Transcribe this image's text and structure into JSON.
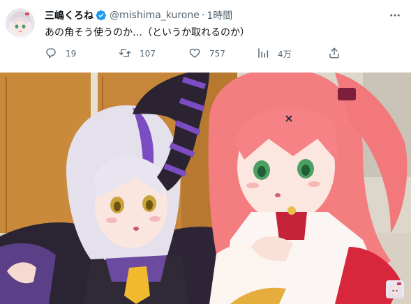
{
  "user": {
    "display_name": "三嶋くろね",
    "handle": "@mishima_kurone",
    "separator": "·",
    "time": "1時間"
  },
  "tweet": {
    "text": "あの角そう使うのか…（というか取れるのか）"
  },
  "actions": {
    "replies": "19",
    "retweets": "107",
    "likes": "757",
    "views": "4万"
  },
  "icons": {
    "verified": "verified-badge-icon",
    "more": "more-dots-icon",
    "reply": "reply-icon",
    "retweet": "retweet-icon",
    "like": "heart-icon",
    "views": "analytics-icon",
    "share": "share-icon"
  },
  "colors": {
    "verified_blue": "#1d9bf0",
    "text_secondary": "#536471",
    "text_primary": "#0f1419"
  }
}
